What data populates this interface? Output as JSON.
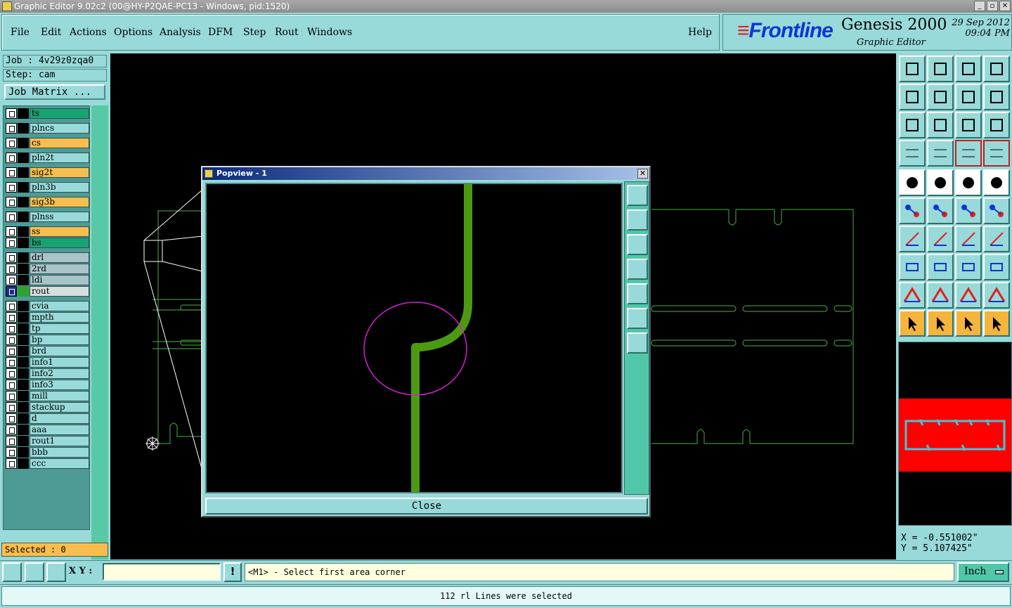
{
  "window": {
    "title": "Graphic Editor 9.02c2 (00@HY-P2QAE-PC13 - Windows, pid:1520)",
    "buttons": [
      "_",
      "▫",
      "✕"
    ]
  },
  "menu": [
    "File",
    "Edit",
    "Actions",
    "Options",
    "Analysis",
    "DFM",
    "Step",
    "Rout",
    "Windows"
  ],
  "help_label": "Help",
  "brand": {
    "logo": "Frontline",
    "product": "Genesis 2000",
    "module": "Graphic Editor",
    "date": "29 Sep 2012",
    "time": "09:04 PM"
  },
  "job": {
    "job_line": "Job : 4v29z0zqa0",
    "step_line": "Step: cam",
    "matrix_button": "Job Matrix ..."
  },
  "layers": [
    {
      "name": "ts",
      "color": "#18a472"
    },
    {
      "name": "plncs",
      "color": "#98dad9"
    },
    {
      "name": "cs",
      "color": "#f7be4e"
    },
    {
      "name": "pln2t",
      "color": "#98dad9"
    },
    {
      "name": "sig2t",
      "color": "#f7be4e"
    },
    {
      "name": "pln3b",
      "color": "#98dad9"
    },
    {
      "name": "sig3b",
      "color": "#f7be4e"
    },
    {
      "name": "plnss",
      "color": "#98dad9"
    },
    {
      "name": "ss",
      "color": "#f7be4e"
    },
    {
      "name": "bs",
      "color": "#18a472"
    },
    {
      "name": "drl",
      "color": "#a8c4c8"
    },
    {
      "name": "2rd",
      "color": "#a8c4c8"
    },
    {
      "name": "ldi",
      "color": "#a8c4c8"
    },
    {
      "name": "rout",
      "color": "#d6dede",
      "affected": true
    },
    {
      "name": "cvia",
      "color": "#98dad9"
    },
    {
      "name": "mpth",
      "color": "#98dad9"
    },
    {
      "name": "tp",
      "color": "#98dad9"
    },
    {
      "name": "bp",
      "color": "#98dad9"
    },
    {
      "name": "brd",
      "color": "#98dad9"
    },
    {
      "name": "info1",
      "color": "#98dad9"
    },
    {
      "name": "info2",
      "color": "#98dad9"
    },
    {
      "name": "info3",
      "color": "#98dad9"
    },
    {
      "name": "mill",
      "color": "#98dad9"
    },
    {
      "name": "stackup",
      "color": "#98dad9"
    },
    {
      "name": "d",
      "color": "#98dad9"
    },
    {
      "name": "aaa",
      "color": "#98dad9"
    },
    {
      "name": "rout1",
      "color": "#98dad9"
    },
    {
      "name": "bbb",
      "color": "#98dad9"
    },
    {
      "name": "ccc",
      "color": "#98dad9"
    }
  ],
  "selected_label": "Selected : 0",
  "popview": {
    "title": "Popview - 1",
    "close_label": "Close"
  },
  "coords": {
    "x": "X = -0.551002\"",
    "y": "Y = 5.107425\""
  },
  "xy_label": "X Y :",
  "xy_input_value": "",
  "prompt": "<M1> - Select first area corner",
  "unit": "Inch",
  "status": "112 rl Lines were selected",
  "colors": {
    "canvas_bg": "#000000",
    "profile_line": "#3f8f3a",
    "feature": "#4c9a12",
    "highlight_circle": "#d020d0",
    "panel": "#98dad9",
    "overview_red": "#ff0000"
  }
}
